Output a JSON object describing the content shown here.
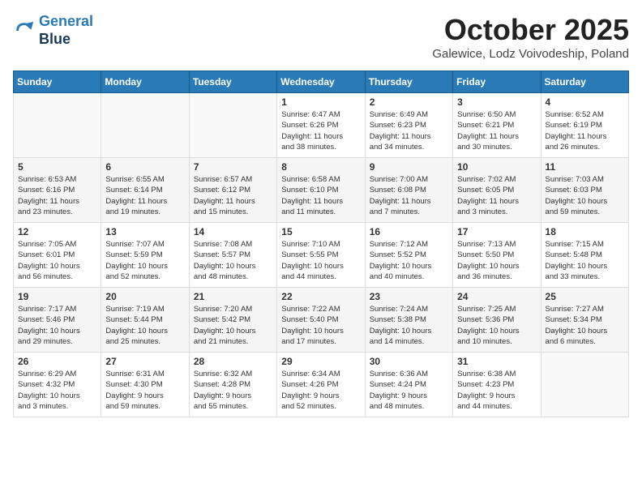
{
  "header": {
    "logo_line1": "General",
    "logo_line2": "Blue",
    "month": "October 2025",
    "location": "Galewice, Lodz Voivodeship, Poland"
  },
  "weekdays": [
    "Sunday",
    "Monday",
    "Tuesday",
    "Wednesday",
    "Thursday",
    "Friday",
    "Saturday"
  ],
  "weeks": [
    [
      {
        "day": "",
        "info": ""
      },
      {
        "day": "",
        "info": ""
      },
      {
        "day": "",
        "info": ""
      },
      {
        "day": "1",
        "info": "Sunrise: 6:47 AM\nSunset: 6:26 PM\nDaylight: 11 hours\nand 38 minutes."
      },
      {
        "day": "2",
        "info": "Sunrise: 6:49 AM\nSunset: 6:23 PM\nDaylight: 11 hours\nand 34 minutes."
      },
      {
        "day": "3",
        "info": "Sunrise: 6:50 AM\nSunset: 6:21 PM\nDaylight: 11 hours\nand 30 minutes."
      },
      {
        "day": "4",
        "info": "Sunrise: 6:52 AM\nSunset: 6:19 PM\nDaylight: 11 hours\nand 26 minutes."
      }
    ],
    [
      {
        "day": "5",
        "info": "Sunrise: 6:53 AM\nSunset: 6:16 PM\nDaylight: 11 hours\nand 23 minutes."
      },
      {
        "day": "6",
        "info": "Sunrise: 6:55 AM\nSunset: 6:14 PM\nDaylight: 11 hours\nand 19 minutes."
      },
      {
        "day": "7",
        "info": "Sunrise: 6:57 AM\nSunset: 6:12 PM\nDaylight: 11 hours\nand 15 minutes."
      },
      {
        "day": "8",
        "info": "Sunrise: 6:58 AM\nSunset: 6:10 PM\nDaylight: 11 hours\nand 11 minutes."
      },
      {
        "day": "9",
        "info": "Sunrise: 7:00 AM\nSunset: 6:08 PM\nDaylight: 11 hours\nand 7 minutes."
      },
      {
        "day": "10",
        "info": "Sunrise: 7:02 AM\nSunset: 6:05 PM\nDaylight: 11 hours\nand 3 minutes."
      },
      {
        "day": "11",
        "info": "Sunrise: 7:03 AM\nSunset: 6:03 PM\nDaylight: 10 hours\nand 59 minutes."
      }
    ],
    [
      {
        "day": "12",
        "info": "Sunrise: 7:05 AM\nSunset: 6:01 PM\nDaylight: 10 hours\nand 56 minutes."
      },
      {
        "day": "13",
        "info": "Sunrise: 7:07 AM\nSunset: 5:59 PM\nDaylight: 10 hours\nand 52 minutes."
      },
      {
        "day": "14",
        "info": "Sunrise: 7:08 AM\nSunset: 5:57 PM\nDaylight: 10 hours\nand 48 minutes."
      },
      {
        "day": "15",
        "info": "Sunrise: 7:10 AM\nSunset: 5:55 PM\nDaylight: 10 hours\nand 44 minutes."
      },
      {
        "day": "16",
        "info": "Sunrise: 7:12 AM\nSunset: 5:52 PM\nDaylight: 10 hours\nand 40 minutes."
      },
      {
        "day": "17",
        "info": "Sunrise: 7:13 AM\nSunset: 5:50 PM\nDaylight: 10 hours\nand 36 minutes."
      },
      {
        "day": "18",
        "info": "Sunrise: 7:15 AM\nSunset: 5:48 PM\nDaylight: 10 hours\nand 33 minutes."
      }
    ],
    [
      {
        "day": "19",
        "info": "Sunrise: 7:17 AM\nSunset: 5:46 PM\nDaylight: 10 hours\nand 29 minutes."
      },
      {
        "day": "20",
        "info": "Sunrise: 7:19 AM\nSunset: 5:44 PM\nDaylight: 10 hours\nand 25 minutes."
      },
      {
        "day": "21",
        "info": "Sunrise: 7:20 AM\nSunset: 5:42 PM\nDaylight: 10 hours\nand 21 minutes."
      },
      {
        "day": "22",
        "info": "Sunrise: 7:22 AM\nSunset: 5:40 PM\nDaylight: 10 hours\nand 17 minutes."
      },
      {
        "day": "23",
        "info": "Sunrise: 7:24 AM\nSunset: 5:38 PM\nDaylight: 10 hours\nand 14 minutes."
      },
      {
        "day": "24",
        "info": "Sunrise: 7:25 AM\nSunset: 5:36 PM\nDaylight: 10 hours\nand 10 minutes."
      },
      {
        "day": "25",
        "info": "Sunrise: 7:27 AM\nSunset: 5:34 PM\nDaylight: 10 hours\nand 6 minutes."
      }
    ],
    [
      {
        "day": "26",
        "info": "Sunrise: 6:29 AM\nSunset: 4:32 PM\nDaylight: 10 hours\nand 3 minutes."
      },
      {
        "day": "27",
        "info": "Sunrise: 6:31 AM\nSunset: 4:30 PM\nDaylight: 9 hours\nand 59 minutes."
      },
      {
        "day": "28",
        "info": "Sunrise: 6:32 AM\nSunset: 4:28 PM\nDaylight: 9 hours\nand 55 minutes."
      },
      {
        "day": "29",
        "info": "Sunrise: 6:34 AM\nSunset: 4:26 PM\nDaylight: 9 hours\nand 52 minutes."
      },
      {
        "day": "30",
        "info": "Sunrise: 6:36 AM\nSunset: 4:24 PM\nDaylight: 9 hours\nand 48 minutes."
      },
      {
        "day": "31",
        "info": "Sunrise: 6:38 AM\nSunset: 4:23 PM\nDaylight: 9 hours\nand 44 minutes."
      },
      {
        "day": "",
        "info": ""
      }
    ]
  ]
}
